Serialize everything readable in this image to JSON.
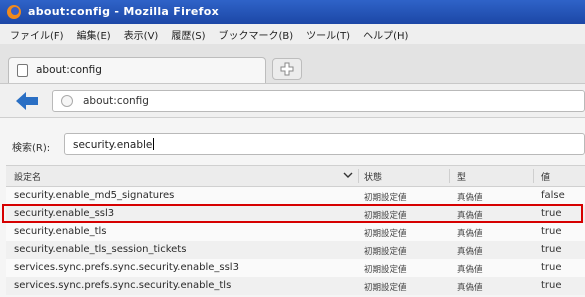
{
  "window": {
    "title": "about:config - Mozilla Firefox",
    "brand_color": "#2450b4"
  },
  "menu": {
    "items": [
      "ファイル(F)",
      "編集(E)",
      "表示(V)",
      "履歴(S)",
      "ブックマーク(B)",
      "ツール(T)",
      "ヘルプ(H)"
    ]
  },
  "tabs": {
    "active_label": "about:config"
  },
  "navbar": {
    "url": "about:config"
  },
  "search": {
    "label": "検索(R):",
    "value": "security.enable"
  },
  "table": {
    "headers": [
      "設定名",
      "状態",
      "型",
      "値"
    ],
    "rows": [
      {
        "name": "security.enable_md5_signatures",
        "status": "初期設定値",
        "type": "真偽値",
        "value": "false"
      },
      {
        "name": "security.enable_ssl3",
        "status": "初期設定値",
        "type": "真偽値",
        "value": "true"
      },
      {
        "name": "security.enable_tls",
        "status": "初期設定値",
        "type": "真偽値",
        "value": "true"
      },
      {
        "name": "security.enable_tls_session_tickets",
        "status": "初期設定値",
        "type": "真偽値",
        "value": "true"
      },
      {
        "name": "services.sync.prefs.sync.security.enable_ssl3",
        "status": "初期設定値",
        "type": "真偽値",
        "value": "true"
      },
      {
        "name": "services.sync.prefs.sync.security.enable_tls",
        "status": "初期設定値",
        "type": "真偽値",
        "value": "true"
      }
    ],
    "highlight_color": "#d60000"
  }
}
